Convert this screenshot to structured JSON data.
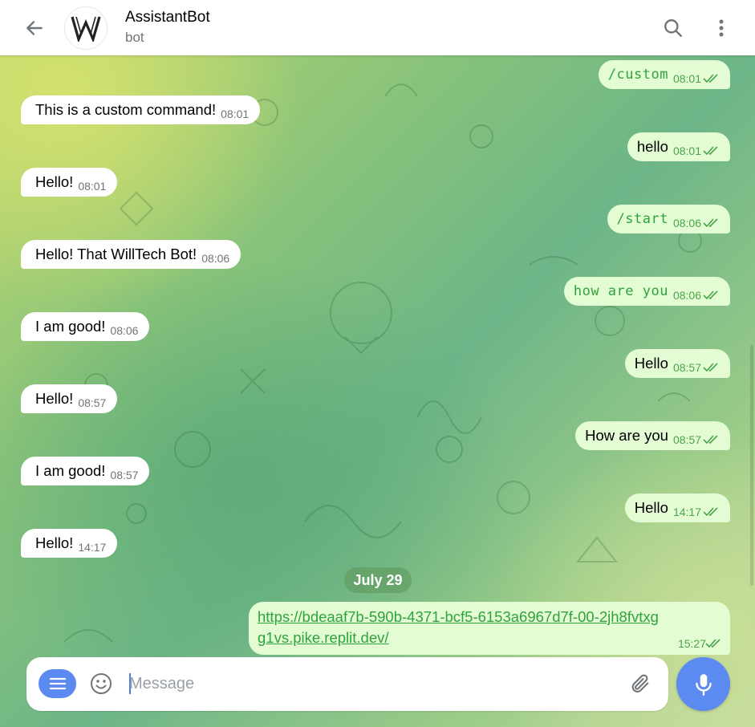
{
  "header": {
    "title": "AssistantBot",
    "status": "bot",
    "back_icon": "arrow-left-icon",
    "search_icon": "search-icon",
    "menu_icon": "more-vertical-icon"
  },
  "messages": [
    {
      "dir": "out",
      "text": "/custom",
      "time": "08:01",
      "mono": true
    },
    {
      "dir": "in",
      "text": "This is a custom command!",
      "time": "08:01"
    },
    {
      "dir": "out",
      "text": "hello",
      "time": "08:01"
    },
    {
      "dir": "in",
      "text": "Hello!",
      "time": "08:01"
    },
    {
      "dir": "out",
      "text": "/start",
      "time": "08:06",
      "mono": true
    },
    {
      "dir": "in",
      "text": "Hello! That WillTech Bot!",
      "time": "08:06"
    },
    {
      "dir": "out",
      "text": "how are you",
      "time": "08:06",
      "mono": true
    },
    {
      "dir": "in",
      "text": "I am good!",
      "time": "08:06"
    },
    {
      "dir": "out",
      "text": "Hello",
      "time": "08:57"
    },
    {
      "dir": "in",
      "text": "Hello!",
      "time": "08:57"
    },
    {
      "dir": "out",
      "text": "How are you",
      "time": "08:57"
    },
    {
      "dir": "in",
      "text": "I am good!",
      "time": "08:57"
    },
    {
      "dir": "out",
      "text": "Hello",
      "time": "14:17"
    },
    {
      "dir": "in",
      "text": "Hello!",
      "time": "14:17"
    }
  ],
  "date_separator": "July 29",
  "link_message": {
    "url": "https://bdeaaf7b-590b-4371-bcf5-6153a6967d7f-00-2jh8fvtxgg1vs.pike.replit.dev/",
    "time": "15:27"
  },
  "composer": {
    "placeholder": "Message",
    "value": ""
  },
  "colors": {
    "accent": "#5b8af0",
    "outgoing_bubble": "#e4fcd4",
    "outgoing_text": "#2fa33b",
    "incoming_bubble": "#ffffff"
  }
}
